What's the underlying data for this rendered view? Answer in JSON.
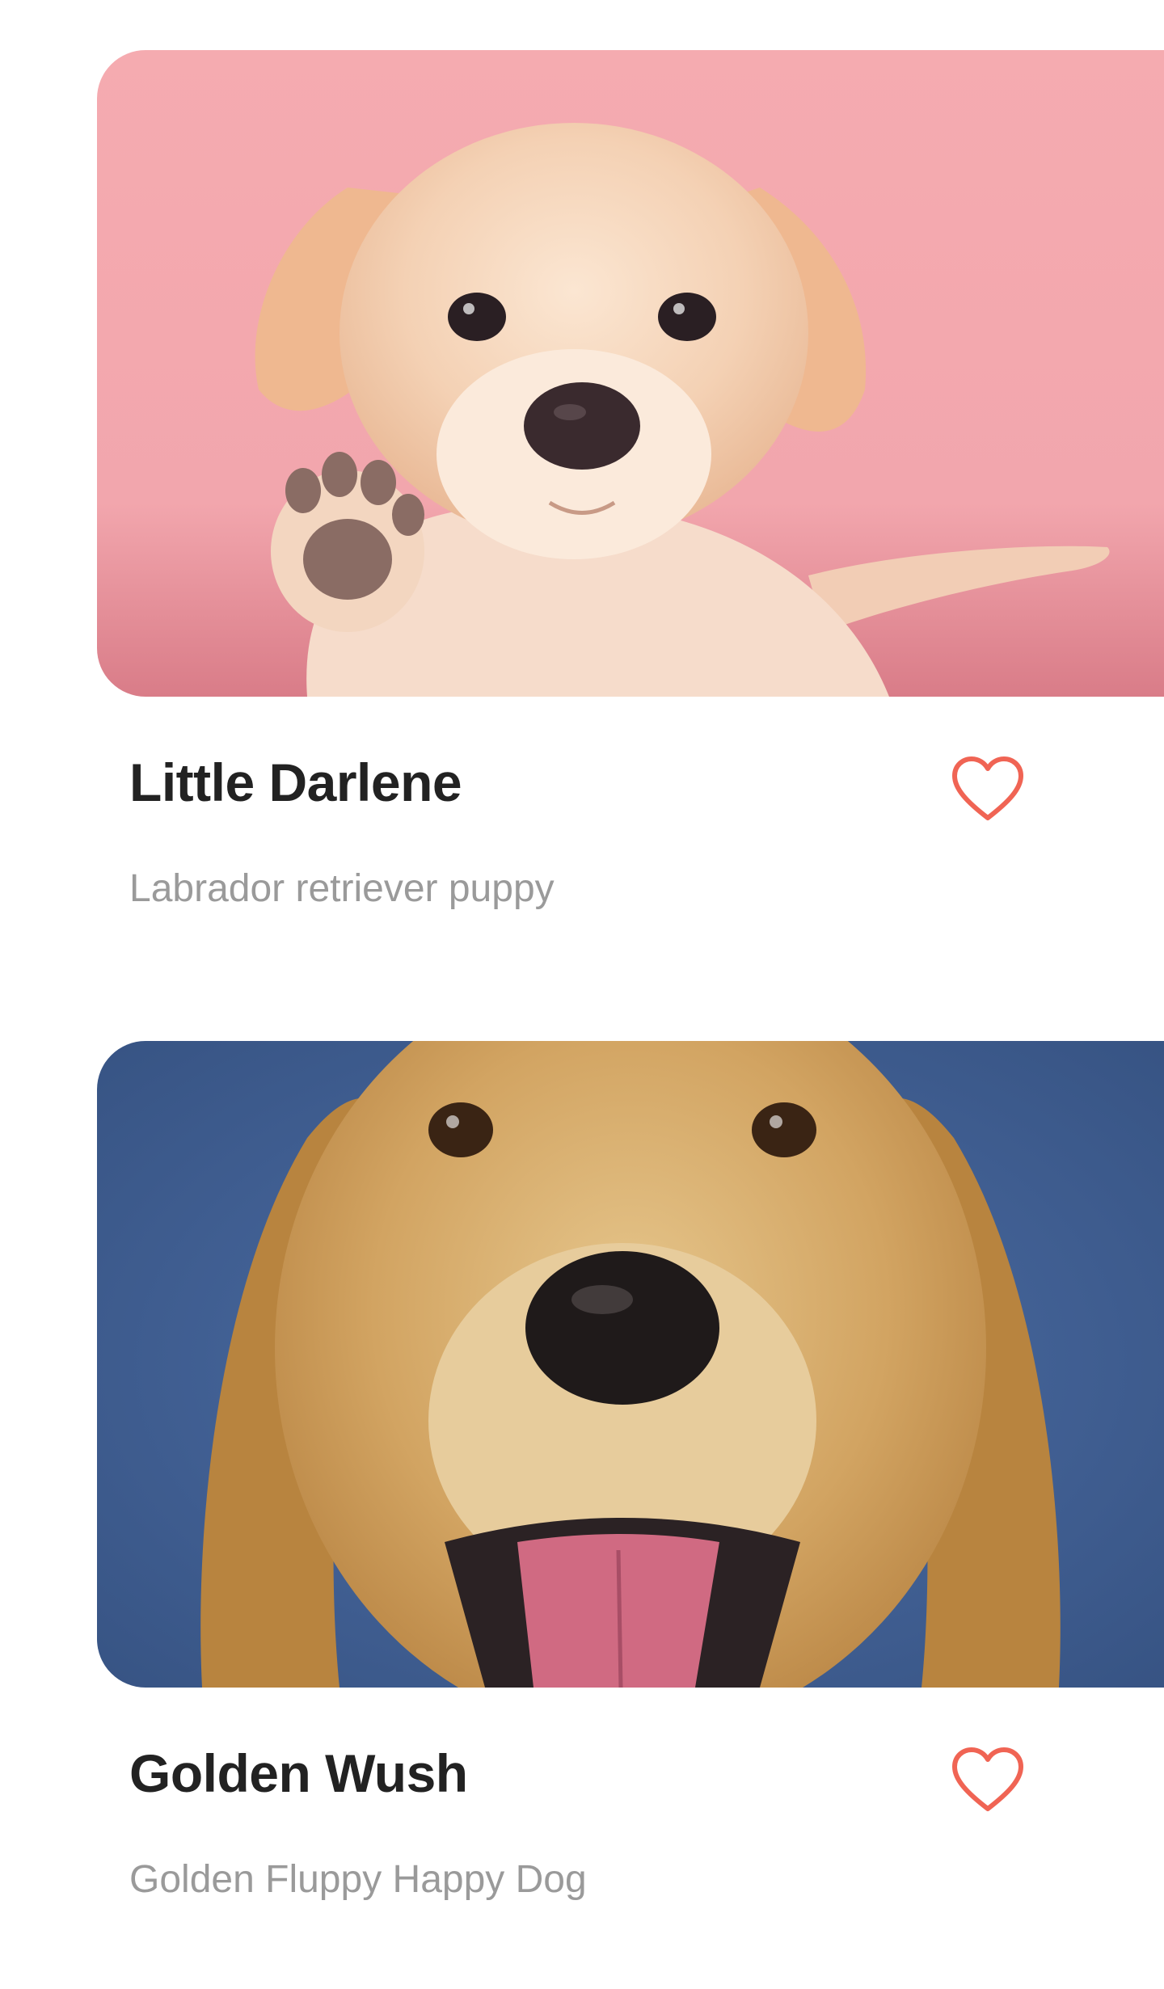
{
  "accent_color": "#f06454",
  "pets": [
    {
      "name": "Little Darlene",
      "description": "Labrador retriever puppy",
      "photo_background": "#f5abb0",
      "icon": "heart-outline-icon"
    },
    {
      "name": "Golden Wush",
      "description": "Golden Fluppy Happy Dog",
      "photo_background": "#3d5e96",
      "icon": "heart-outline-icon"
    }
  ]
}
